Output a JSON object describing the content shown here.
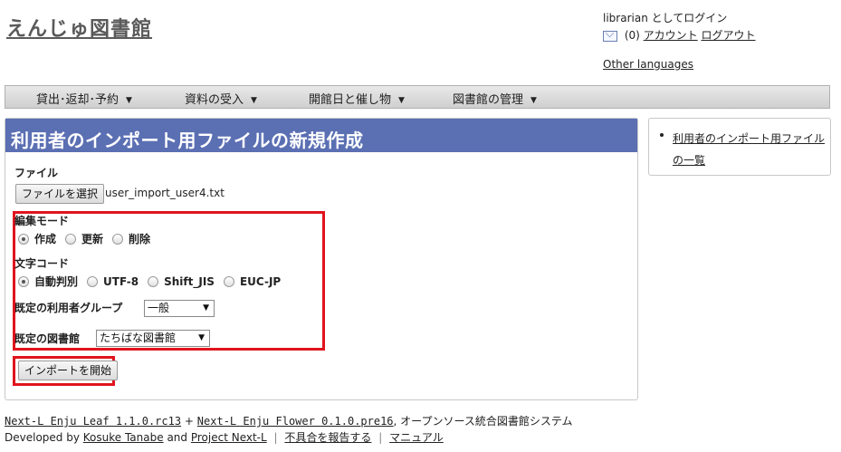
{
  "header": {
    "site_title": "えんじゅ図書館",
    "login_status": "librarian としてログイン",
    "mail_count": "(0)",
    "account_link": "アカウント",
    "logout_link": "ログアウト",
    "other_languages": "Other languages"
  },
  "menu": {
    "items": [
      {
        "label": "貸出･返却･予約"
      },
      {
        "label": "資料の受入"
      },
      {
        "label": "開館日と催し物"
      },
      {
        "label": "図書館の管理"
      }
    ]
  },
  "main": {
    "title": "利用者のインポート用ファイルの新規作成",
    "file_label": "ファイル",
    "file_button": "ファイルを選択",
    "file_name": "user_import_user4.txt",
    "edit_mode_label": "編集モード",
    "edit_mode_options": [
      {
        "label": "作成",
        "checked": true
      },
      {
        "label": "更新",
        "checked": false
      },
      {
        "label": "削除",
        "checked": false
      }
    ],
    "encoding_label": "文字コード",
    "encoding_options": [
      {
        "label": "自動判別",
        "checked": true
      },
      {
        "label": "UTF-8",
        "checked": false
      },
      {
        "label": "Shift_JIS",
        "checked": false
      },
      {
        "label": "EUC-JP",
        "checked": false
      }
    ],
    "default_group_label": "既定の利用者グループ",
    "default_group_value": "一般",
    "default_library_label": "既定の図書館",
    "default_library_value": "たちばな図書館",
    "submit_button": "インポートを開始"
  },
  "sidebar": {
    "link": "利用者のインポート用ファイルの一覧"
  },
  "footer": {
    "leaf": "Next-L Enju Leaf 1.1.0.rc13",
    "plus": "+",
    "flower": "Next-L Enju Flower 0.1.0.pre16",
    "system_desc": ", オープンソース統合図書館システム",
    "developed_by": "Developed by",
    "author": "Kosuke Tanabe",
    "and": "and",
    "project": "Project Next-L",
    "report_bug": "不具合を報告する",
    "manual": "マニュアル",
    "separator": "|"
  }
}
